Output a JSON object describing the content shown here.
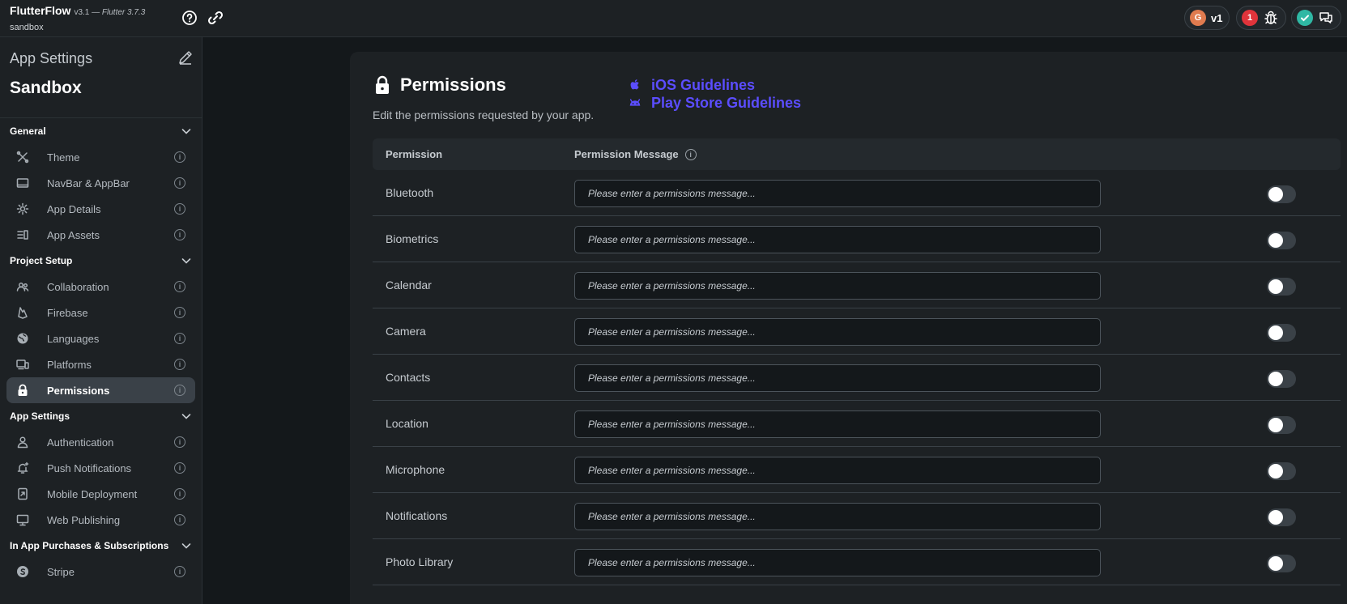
{
  "topbar": {
    "app_name": "FlutterFlow",
    "version": "v3.1 — ",
    "flutter_version": "Flutter 3.7.3",
    "project": "sandbox",
    "version_badge": "v1",
    "error_count": "1"
  },
  "sidebar": {
    "title": "App Settings",
    "project_name": "Sandbox",
    "sections": [
      {
        "label": "General",
        "items": [
          {
            "label": "Theme",
            "icon": "theme-icon"
          },
          {
            "label": "NavBar & AppBar",
            "icon": "navbar-icon"
          },
          {
            "label": "App Details",
            "icon": "app-details-icon"
          },
          {
            "label": "App Assets",
            "icon": "app-assets-icon"
          }
        ]
      },
      {
        "label": "Project Setup",
        "items": [
          {
            "label": "Collaboration",
            "icon": "collaboration-icon"
          },
          {
            "label": "Firebase",
            "icon": "firebase-icon"
          },
          {
            "label": "Languages",
            "icon": "globe-icon"
          },
          {
            "label": "Platforms",
            "icon": "platforms-icon"
          },
          {
            "label": "Permissions",
            "icon": "lock-icon",
            "active": true
          }
        ]
      },
      {
        "label": "App Settings",
        "items": [
          {
            "label": "Authentication",
            "icon": "person-icon"
          },
          {
            "label": "Push Notifications",
            "icon": "bell-icon"
          },
          {
            "label": "Mobile Deployment",
            "icon": "mobile-deploy-icon"
          },
          {
            "label": "Web Publishing",
            "icon": "monitor-icon"
          }
        ]
      },
      {
        "label": "In App Purchases & Subscriptions",
        "items": [
          {
            "label": "Stripe",
            "icon": "stripe-icon"
          }
        ]
      }
    ]
  },
  "main": {
    "title": "Permissions",
    "description": "Edit the permissions requested by your app.",
    "ios_guidelines": "iOS Guidelines",
    "play_guidelines": "Play Store Guidelines",
    "col_permission": "Permission",
    "col_message": "Permission Message",
    "placeholder": "Please enter a permissions message...",
    "permissions": [
      {
        "name": "Bluetooth",
        "enabled": false
      },
      {
        "name": "Biometrics",
        "enabled": false
      },
      {
        "name": "Calendar",
        "enabled": false
      },
      {
        "name": "Camera",
        "enabled": false
      },
      {
        "name": "Contacts",
        "enabled": false
      },
      {
        "name": "Location",
        "enabled": false
      },
      {
        "name": "Microphone",
        "enabled": false
      },
      {
        "name": "Notifications",
        "enabled": false
      },
      {
        "name": "Photo Library",
        "enabled": false
      }
    ]
  },
  "colors": {
    "accent": "#5b4dff",
    "background": "#14181b",
    "panel": "#1d2124",
    "active_item": "#3a4148",
    "error_badge": "#e0343b",
    "success_badge": "#2fb8a4",
    "git_badge": "#e07b4f"
  }
}
